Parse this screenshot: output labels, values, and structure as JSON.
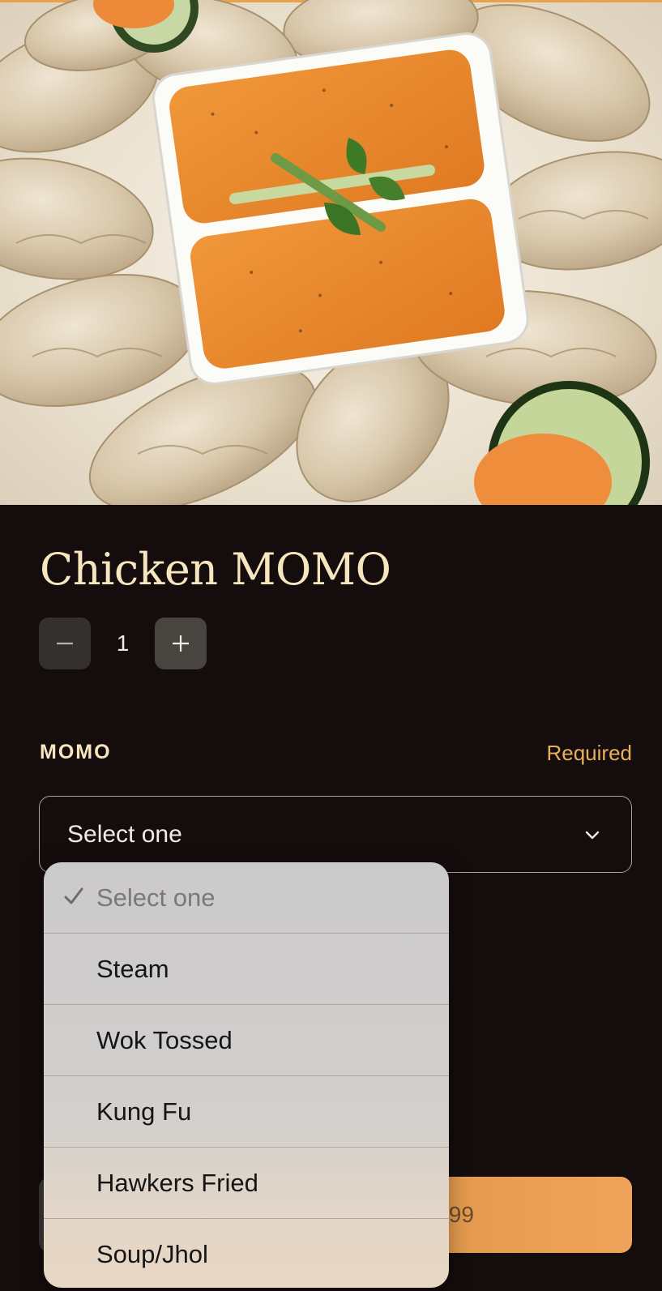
{
  "product": {
    "title": "Chicken MOMO",
    "quantity": "1",
    "minus_symbol": "−",
    "plus_symbol": "+"
  },
  "option_group": {
    "label": "MOMO",
    "required_text": "Required",
    "selected_value": "Select one"
  },
  "dropdown": {
    "options": [
      {
        "label": "Select one",
        "selected": true
      },
      {
        "label": "Steam",
        "selected": false
      },
      {
        "label": "Wok Tossed",
        "selected": false
      },
      {
        "label": "Kung Fu",
        "selected": false
      },
      {
        "label": "Hawkers Fried",
        "selected": false
      },
      {
        "label": "Soup/Jhol",
        "selected": false
      }
    ]
  },
  "cart_button": {
    "visible_price_fragment": ".99"
  },
  "colors": {
    "background": "#140c0d",
    "title": "#f7e6bd",
    "required": "#e7b15c",
    "cart_button": "#eba257"
  },
  "icons": {
    "select_chevron": "chevron-down-icon",
    "dropdown_check": "checkmark-icon"
  }
}
